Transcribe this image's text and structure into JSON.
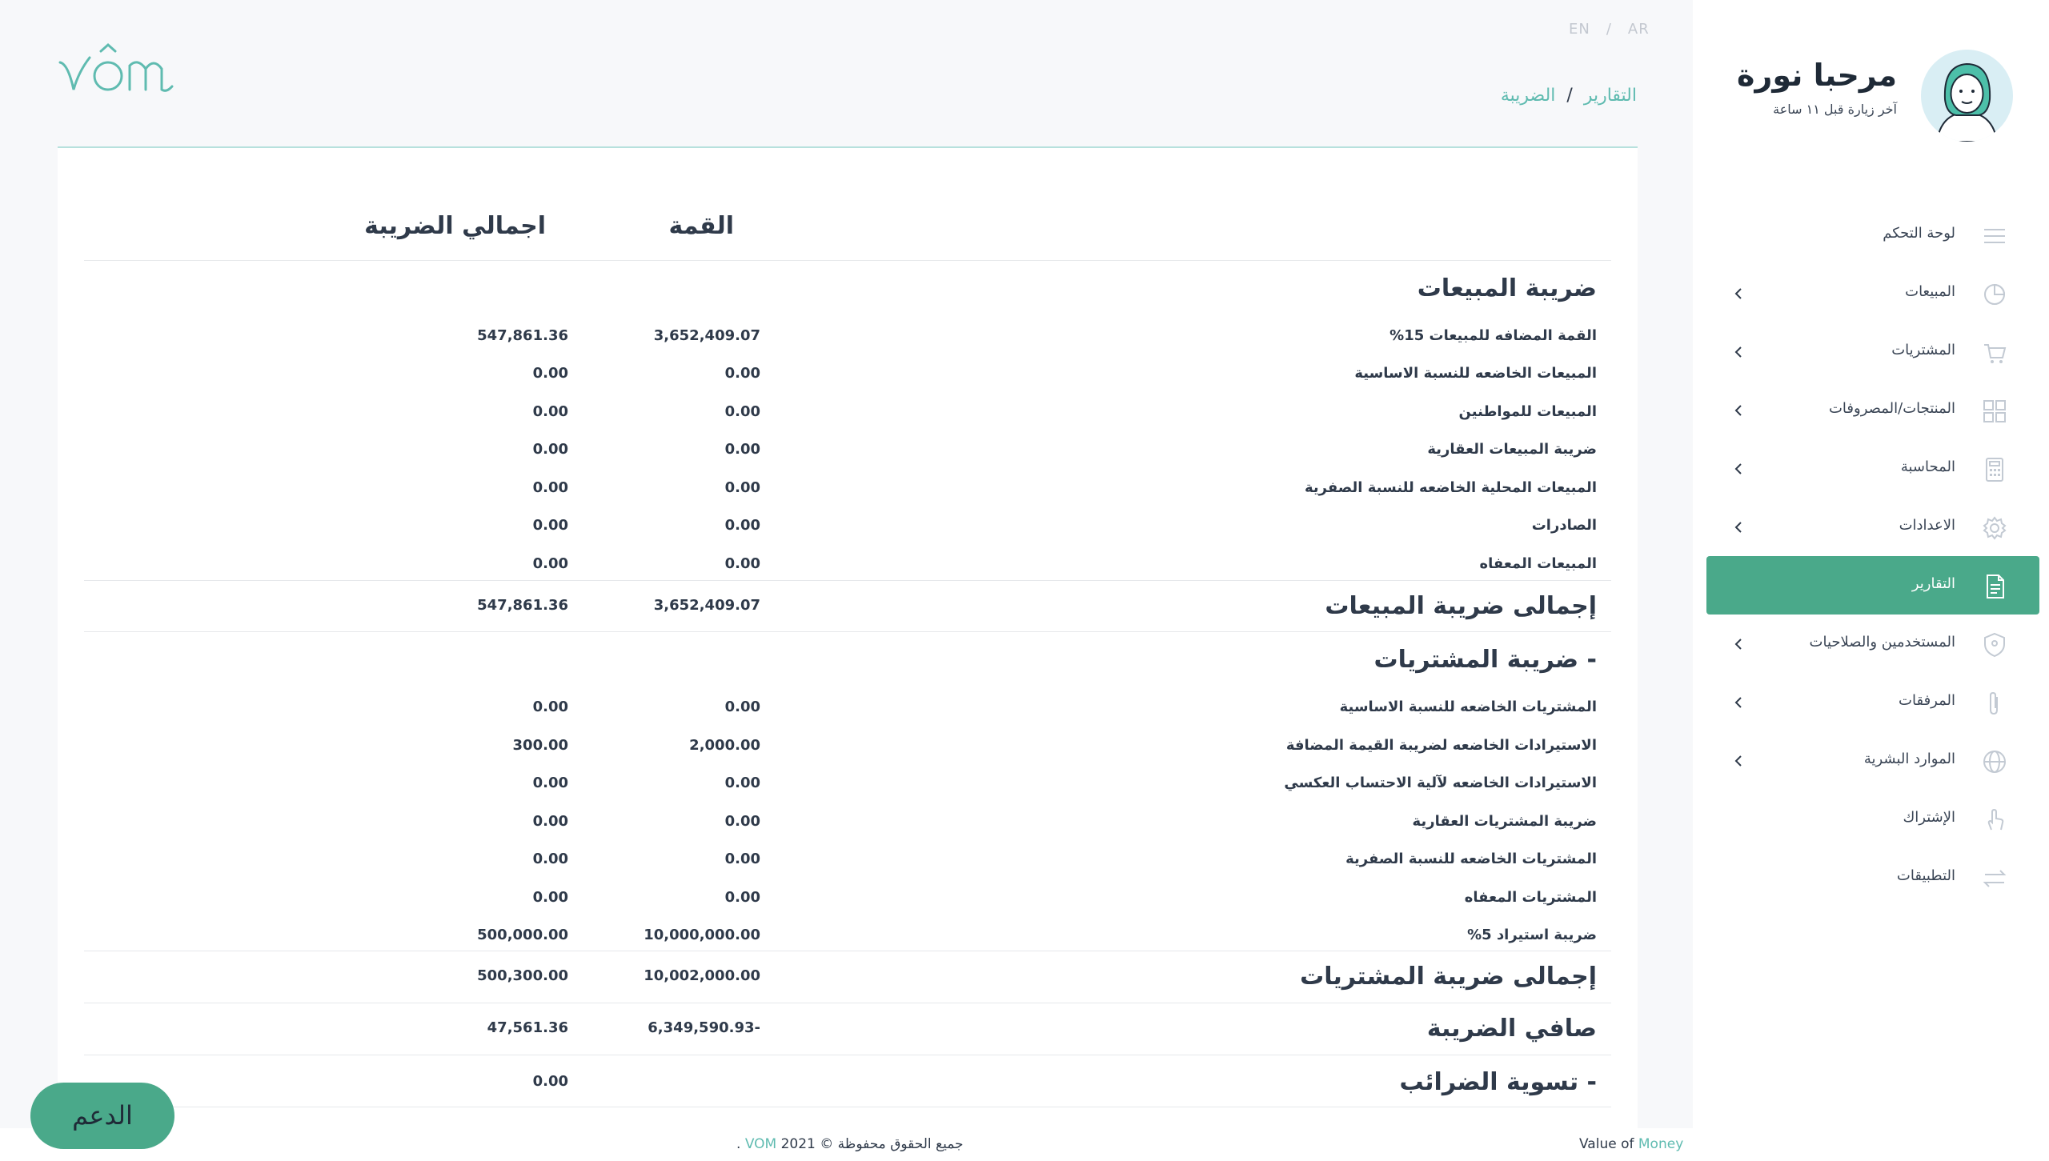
{
  "user": {
    "greeting": "مرحبا نورة",
    "last_visit": "آخر زيارة قبل ١١ ساعة"
  },
  "language": {
    "en": "EN",
    "ar": "AR",
    "separator": "/"
  },
  "breadcrumb": {
    "parent": "التقارير",
    "separator": "/",
    "current": "الضريبة"
  },
  "sidebar": {
    "items": [
      {
        "label": "لوحة التحكم",
        "icon": "menu-icon",
        "chevron": false,
        "active": false
      },
      {
        "label": "المبيعات",
        "icon": "sales-icon",
        "chevron": true,
        "active": false
      },
      {
        "label": "المشتريات",
        "icon": "cart-icon",
        "chevron": true,
        "active": false
      },
      {
        "label": "المنتجات/المصروفات",
        "icon": "grid-icon",
        "chevron": true,
        "active": false
      },
      {
        "label": "المحاسبة",
        "icon": "calculator-icon",
        "chevron": true,
        "active": false
      },
      {
        "label": "الاعدادات",
        "icon": "gear-icon",
        "chevron": true,
        "active": false
      },
      {
        "label": "التقارير",
        "icon": "report-icon",
        "chevron": false,
        "active": true
      },
      {
        "label": "المستخدمين والصلاحيات",
        "icon": "shield-icon",
        "chevron": true,
        "active": false
      },
      {
        "label": "المرفقات",
        "icon": "paperclip-icon",
        "chevron": true,
        "active": false
      },
      {
        "label": "الموارد البشرية",
        "icon": "globe-icon",
        "chevron": true,
        "active": false
      },
      {
        "label": "الإشتراك",
        "icon": "hand-icon",
        "chevron": false,
        "active": false
      },
      {
        "label": "التطبيقات",
        "icon": "exchange-icon",
        "chevron": false,
        "active": false
      }
    ]
  },
  "table": {
    "col_value": "القمة",
    "col_tax": "اجمالي الضريبة",
    "sales_section": "ضريبة المبيعات",
    "sales_rows": [
      {
        "label": "القمة المضافه للمبيعات 15%",
        "value": "3,652,409.07",
        "tax": "547,861.36"
      },
      {
        "label": "المبيعات الخاضعه للنسبة الاساسية",
        "value": "0.00",
        "tax": "0.00"
      },
      {
        "label": "المبيعات للمواطنين",
        "value": "0.00",
        "tax": "0.00"
      },
      {
        "label": "ضريبة المبيعات العقارية",
        "value": "0.00",
        "tax": "0.00"
      },
      {
        "label": "المبيعات المحلية الخاضعه للنسبة الصفرية",
        "value": "0.00",
        "tax": "0.00"
      },
      {
        "label": "الصادرات",
        "value": "0.00",
        "tax": "0.00"
      },
      {
        "label": "المبيعات المعفاه",
        "value": "0.00",
        "tax": "0.00"
      }
    ],
    "sales_total": {
      "label": "إجمالى ضريبة المبيعات",
      "value": "3,652,409.07",
      "tax": "547,861.36"
    },
    "purchases_section": "- ضريبة المشتريات",
    "purchase_rows": [
      {
        "label": "المشتريات الخاضعه للنسبة الاساسية",
        "value": "0.00",
        "tax": "0.00"
      },
      {
        "label": "الاستيرادات الخاضعه لضريبة القيمة المضافة",
        "value": "2,000.00",
        "tax": "300.00"
      },
      {
        "label": "الاستيرادات الخاضعه لآلية الاحتساب العكسي",
        "value": "0.00",
        "tax": "0.00"
      },
      {
        "label": "ضريبة المشتريات العقارية",
        "value": "0.00",
        "tax": "0.00"
      },
      {
        "label": "المشتريات الخاضعه للنسبة الصفرية",
        "value": "0.00",
        "tax": "0.00"
      },
      {
        "label": "المشتريات المعفاه",
        "value": "0.00",
        "tax": "0.00"
      },
      {
        "label": "ضريبة استيراد 5%",
        "value": "10,000,000.00",
        "tax": "500,000.00"
      }
    ],
    "purchases_total": {
      "label": "إجمالى ضريبة المشتريات",
      "value": "10,002,000.00",
      "tax": "500,300.00"
    },
    "net_tax": {
      "label": "صافي الضريبة",
      "value": "6,349,590.93-",
      "tax": "47,561.36"
    },
    "settlement": {
      "label": "- تسوية الضرائب",
      "tax": "0.00"
    }
  },
  "footer": {
    "copyright_prefix": "جميع الحقوق محفوظة © 2021",
    "copyright_brand": "VOM",
    "copyright_suffix": ".",
    "tagline_prefix": "Value of",
    "tagline_accent": "Money"
  },
  "support_button": "الدعم",
  "colors": {
    "accent": "#4aa98a",
    "link": "#5fbbb0",
    "text": "#2f3a4a"
  }
}
